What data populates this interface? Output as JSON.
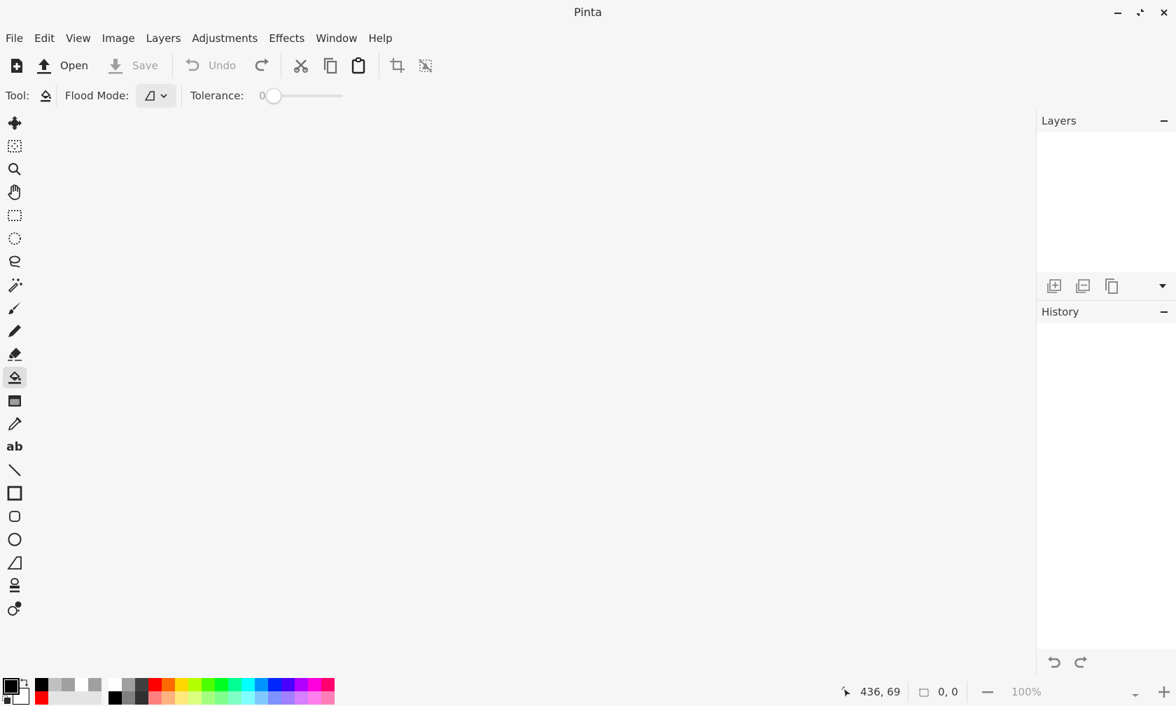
{
  "window": {
    "title": "Pinta",
    "controls": [
      "minimize",
      "restore",
      "close"
    ]
  },
  "menubar": [
    "File",
    "Edit",
    "View",
    "Image",
    "Layers",
    "Adjustments",
    "Effects",
    "Window",
    "Help"
  ],
  "toolbar": {
    "new_icon": "new-image-icon",
    "open_label": "Open",
    "save_label": "Save",
    "undo_label": "Undo",
    "redo_icon": "redo-icon",
    "cut_icon": "cut-icon",
    "copy_icon": "copy-icon",
    "paste_icon": "paste-icon",
    "crop_icon": "crop-to-selection-icon",
    "deselect_icon": "deselect-icon",
    "save_enabled": false,
    "undo_enabled": false
  },
  "tool_options": {
    "tool_label": "Tool:",
    "current_tool_icon": "paint-bucket-icon",
    "flood_mode_label": "Flood Mode:",
    "flood_mode_value": "contiguous",
    "tolerance_label": "Tolerance:",
    "tolerance_value": "0",
    "tolerance_percent": 0
  },
  "tools": [
    {
      "name": "move-selected",
      "active": false
    },
    {
      "name": "move-selection",
      "active": false
    },
    {
      "name": "zoom",
      "active": false
    },
    {
      "name": "pan",
      "active": false
    },
    {
      "name": "rectangle-select",
      "active": false
    },
    {
      "name": "ellipse-select",
      "active": false
    },
    {
      "name": "lasso-select",
      "active": false
    },
    {
      "name": "magic-wand",
      "active": false
    },
    {
      "name": "paintbrush",
      "active": false
    },
    {
      "name": "pencil",
      "active": false
    },
    {
      "name": "eraser",
      "active": false
    },
    {
      "name": "paint-bucket",
      "active": true
    },
    {
      "name": "gradient",
      "active": false
    },
    {
      "name": "color-picker",
      "active": false
    },
    {
      "name": "text",
      "active": false
    },
    {
      "name": "line-curve",
      "active": false
    },
    {
      "name": "rectangle",
      "active": false
    },
    {
      "name": "rounded-rectangle",
      "active": false
    },
    {
      "name": "ellipse",
      "active": false
    },
    {
      "name": "freeform-shape",
      "active": false
    },
    {
      "name": "clone-stamp",
      "active": false
    },
    {
      "name": "recolor",
      "active": false
    }
  ],
  "panels": {
    "layers": {
      "title": "Layers",
      "items": []
    },
    "history": {
      "title": "History",
      "items": []
    }
  },
  "palette": {
    "primary": "#000000",
    "secondary": "#ffffff",
    "recent_top": [
      "#000000",
      "#c0c0c0",
      "#a0a0a0",
      "#ffffff",
      "#a0a0a0"
    ],
    "recent_bottom": [
      "#ff0000",
      "#e4e4e4",
      "#e4e4e4",
      "#e4e4e4",
      "#e4e4e4"
    ],
    "main_top": [
      "#ffffff",
      "#a0a0a0",
      "#404040",
      "#ff0000",
      "#ff6a00",
      "#ffd800",
      "#b6ff00",
      "#4cff00",
      "#00ff21",
      "#00ff90",
      "#00ffff",
      "#0094ff",
      "#0026ff",
      "#4800ff",
      "#b200ff",
      "#ff00dc",
      "#ff006e"
    ],
    "main_bottom": [
      "#000000",
      "#808080",
      "#303030",
      "#ff7f7f",
      "#ffb27f",
      "#ffe97f",
      "#daff7f",
      "#a5ff7f",
      "#7fff8e",
      "#7fffc5",
      "#7fffff",
      "#7fc9ff",
      "#7f92ff",
      "#a17fff",
      "#d67fff",
      "#ff7fed",
      "#ff7fb6"
    ]
  },
  "status": {
    "cursor_position": "436, 69",
    "selection_size": "0, 0",
    "zoom": "100%"
  }
}
